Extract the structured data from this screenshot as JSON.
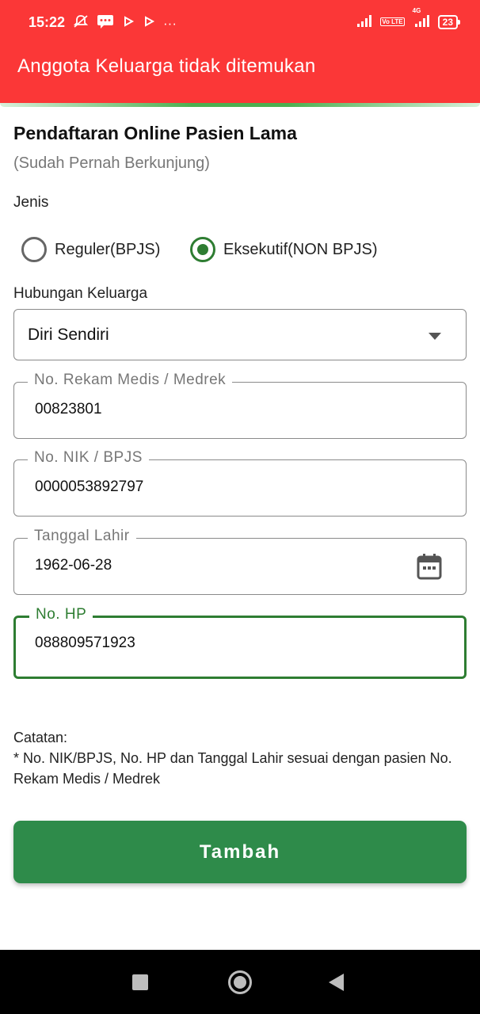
{
  "status_bar": {
    "time": "15:22",
    "battery": "23",
    "volte": "Vo LTE",
    "network": "4G",
    "more": "···"
  },
  "banner": {
    "text": "Anggota Keluarga tidak ditemukan",
    "color": "#fb3737"
  },
  "form": {
    "title": "Pendaftaran Online Pasien Lama",
    "subtitle": "(Sudah Pernah Berkunjung)",
    "jenis_label": "Jenis",
    "jenis_options": [
      {
        "label": "Reguler(BPJS)",
        "selected": false
      },
      {
        "label": "Eksekutif(NON BPJS)",
        "selected": true
      }
    ],
    "hubungan_label": "Hubungan Keluarga",
    "hubungan_value": "Diri Sendiri",
    "fields": {
      "rekam_medis": {
        "label": "No. Rekam Medis / Medrek",
        "value": "00823801"
      },
      "nik": {
        "label": "No. NIK / BPJS",
        "value": "0000053892797"
      },
      "tanggal_lahir": {
        "label": "Tanggal Lahir",
        "value": "1962-06-28"
      },
      "no_hp": {
        "label": "No. HP",
        "value": "088809571923"
      }
    },
    "note_title": "Catatan:",
    "note_body": "* No. NIK/BPJS, No. HP dan Tanggal Lahir sesuai dengan pasien No. Rekam Medis / Medrek",
    "submit_label": "Tambah",
    "accent_color": "#2e7d32"
  }
}
